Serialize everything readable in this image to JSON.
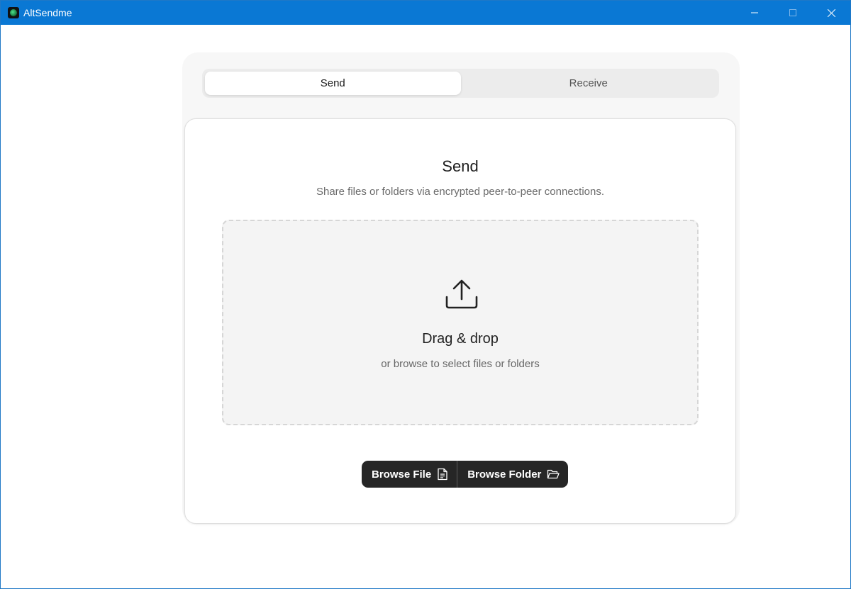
{
  "window": {
    "title": "AltSendme"
  },
  "tabs": [
    {
      "label": "Send",
      "active": true
    },
    {
      "label": "Receive",
      "active": false
    }
  ],
  "panel": {
    "title": "Send",
    "subtitle": "Share files or folders via encrypted peer-to-peer connections."
  },
  "dropzone": {
    "icon": "upload-icon",
    "title": "Drag & drop",
    "subtitle": "or browse to select files or folders"
  },
  "actions": {
    "browse_file": "Browse File",
    "browse_file_icon": "file-icon",
    "browse_folder": "Browse Folder",
    "browse_folder_icon": "folder-open-icon"
  },
  "colors": {
    "titlebar": "#0a78d4",
    "button_bg": "#262626",
    "card_bg": "#f7f7f7"
  }
}
